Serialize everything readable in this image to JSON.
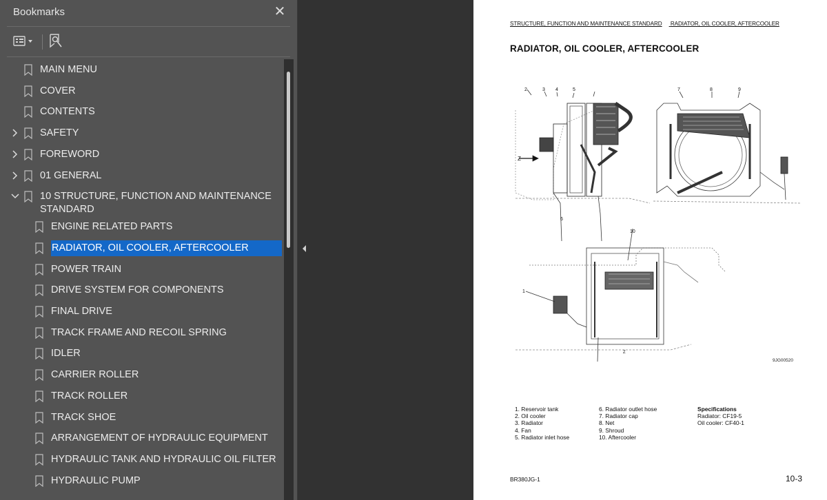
{
  "bookmarks_panel": {
    "title": "Bookmarks",
    "close_label": "✕",
    "items": [
      {
        "label": "MAIN MENU",
        "level": 0,
        "expander": "none"
      },
      {
        "label": "COVER",
        "level": 0,
        "expander": "none"
      },
      {
        "label": "CONTENTS",
        "level": 0,
        "expander": "none"
      },
      {
        "label": "SAFETY",
        "level": 0,
        "expander": "collapsed"
      },
      {
        "label": "FOREWORD",
        "level": 0,
        "expander": "collapsed"
      },
      {
        "label": "01  GENERAL",
        "level": 0,
        "expander": "collapsed"
      },
      {
        "label": "10  STRUCTURE, FUNCTION AND MAINTENANCE STANDARD",
        "level": 0,
        "expander": "expanded"
      },
      {
        "label": "ENGINE RELATED PARTS",
        "level": 1,
        "expander": "none"
      },
      {
        "label": "RADIATOR, OIL COOLER, AFTERCOOLER",
        "level": 1,
        "expander": "none",
        "selected": true
      },
      {
        "label": "POWER TRAIN",
        "level": 1,
        "expander": "none"
      },
      {
        "label": "DRIVE SYSTEM FOR COMPONENTS",
        "level": 1,
        "expander": "none"
      },
      {
        "label": "FINAL DRIVE",
        "level": 1,
        "expander": "none"
      },
      {
        "label": "TRACK FRAME AND RECOIL SPRING",
        "level": 1,
        "expander": "none"
      },
      {
        "label": "IDLER",
        "level": 1,
        "expander": "none"
      },
      {
        "label": "CARRIER ROLLER",
        "level": 1,
        "expander": "none"
      },
      {
        "label": "TRACK ROLLER",
        "level": 1,
        "expander": "none"
      },
      {
        "label": "TRACK SHOE",
        "level": 1,
        "expander": "none"
      },
      {
        "label": "ARRANGEMENT OF HYDRAULIC EQUIPMENT",
        "level": 1,
        "expander": "none"
      },
      {
        "label": "HYDRAULIC TANK AND HYDRAULIC OIL FILTER",
        "level": 1,
        "expander": "none"
      },
      {
        "label": "HYDRAULIC PUMP",
        "level": 1,
        "expander": "none"
      }
    ],
    "selection_color": "#1468c8"
  },
  "document": {
    "header_left": "STRUCTURE, FUNCTION AND MAINTENANCE STANDARD",
    "header_right": "RADIATOR, OIL COOLER, AFTERCOOLER",
    "title": "RADIATOR, OIL COOLER, AFTERCOOLER",
    "figure_code": "9JG00520",
    "figure_callouts": [
      "1",
      "2",
      "3",
      "4",
      "5",
      "6",
      "7",
      "8",
      "9",
      "10",
      "Z",
      "Z"
    ],
    "legend_col1": [
      "1. Reservoir tank",
      "2. Oil cooler",
      "3. Radiator",
      "4. Fan",
      "5. Radiator inlet hose"
    ],
    "legend_col2": [
      "6. Radiator outlet hose",
      "7. Radiator cap",
      "8. Net",
      "9. Shroud",
      "10. Aftercooler"
    ],
    "specs_title": "Specifications",
    "specs": [
      "Radiator:    CF19-5",
      "Oil cooler:   CF40-1"
    ],
    "footer_left": "BR380JG-1",
    "footer_right": "10-3"
  }
}
